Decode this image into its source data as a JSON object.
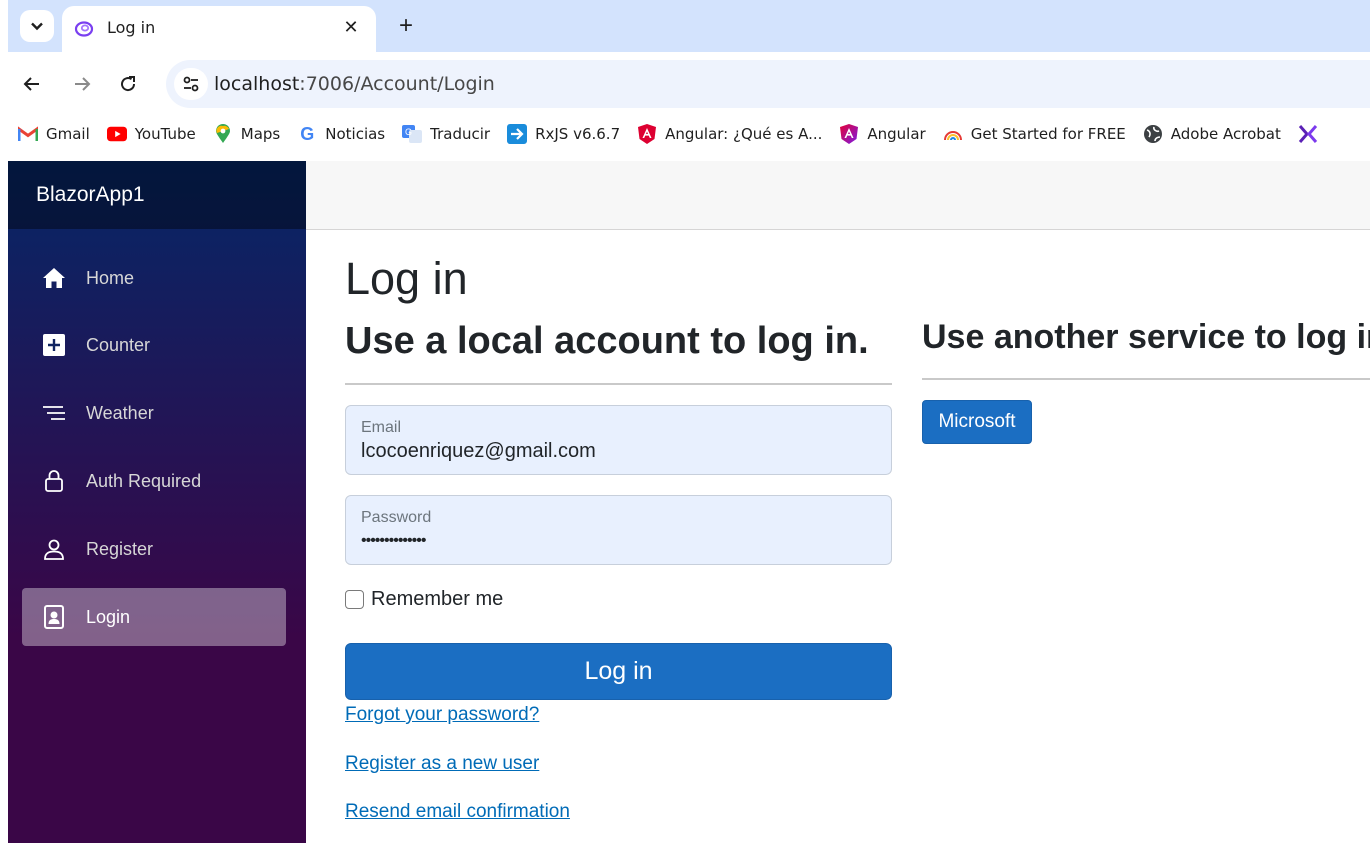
{
  "browser": {
    "tab_title": "Log in",
    "tab_close": "✕",
    "new_tab": "+",
    "url_host": "localhost",
    "url_rest": ":7006/Account/Login",
    "bookmarks": [
      {
        "label": "Gmail",
        "icon": "gmail-icon"
      },
      {
        "label": "YouTube",
        "icon": "youtube-icon"
      },
      {
        "label": "Maps",
        "icon": "maps-icon"
      },
      {
        "label": "Noticias",
        "icon": "google-news-icon"
      },
      {
        "label": "Traducir",
        "icon": "translate-icon"
      },
      {
        "label": "RxJS v6.6.7",
        "icon": "rxjs-icon"
      },
      {
        "label": "Angular: ¿Qué es A...",
        "icon": "angular-icon"
      },
      {
        "label": "Angular",
        "icon": "angular-color-icon"
      },
      {
        "label": "Get Started for FREE",
        "icon": "rainbow-icon"
      },
      {
        "label": "Adobe Acrobat",
        "icon": "globe-icon"
      },
      {
        "label": "",
        "icon": "x-logo-icon"
      }
    ]
  },
  "app": {
    "brand": "BlazorApp1",
    "nav": [
      {
        "label": "Home",
        "icon": "home-icon"
      },
      {
        "label": "Counter",
        "icon": "plus-square-icon"
      },
      {
        "label": "Weather",
        "icon": "list-icon"
      },
      {
        "label": "Auth Required",
        "icon": "lock-icon"
      },
      {
        "label": "Register",
        "icon": "person-icon"
      },
      {
        "label": "Login",
        "icon": "person-badge-icon",
        "active": true
      }
    ]
  },
  "login": {
    "title": "Log in",
    "local_heading": "Use a local account to log in.",
    "email_label": "Email",
    "email_value": "lcocoenriquez@gmail.com",
    "password_label": "Password",
    "password_value": "••••••••••••••",
    "remember_label": "Remember me",
    "submit_label": "Log in",
    "forgot_link": "Forgot your password?",
    "register_link": "Register as a new user",
    "resend_link": "Resend email confirmation"
  },
  "external": {
    "heading": "Use another service to log in.",
    "microsoft_label": "Microsoft"
  },
  "colors": {
    "accent": "#1b6ec2",
    "link": "#006bb7",
    "sidebar_top": "#052767",
    "sidebar_bottom": "#3a0647"
  }
}
